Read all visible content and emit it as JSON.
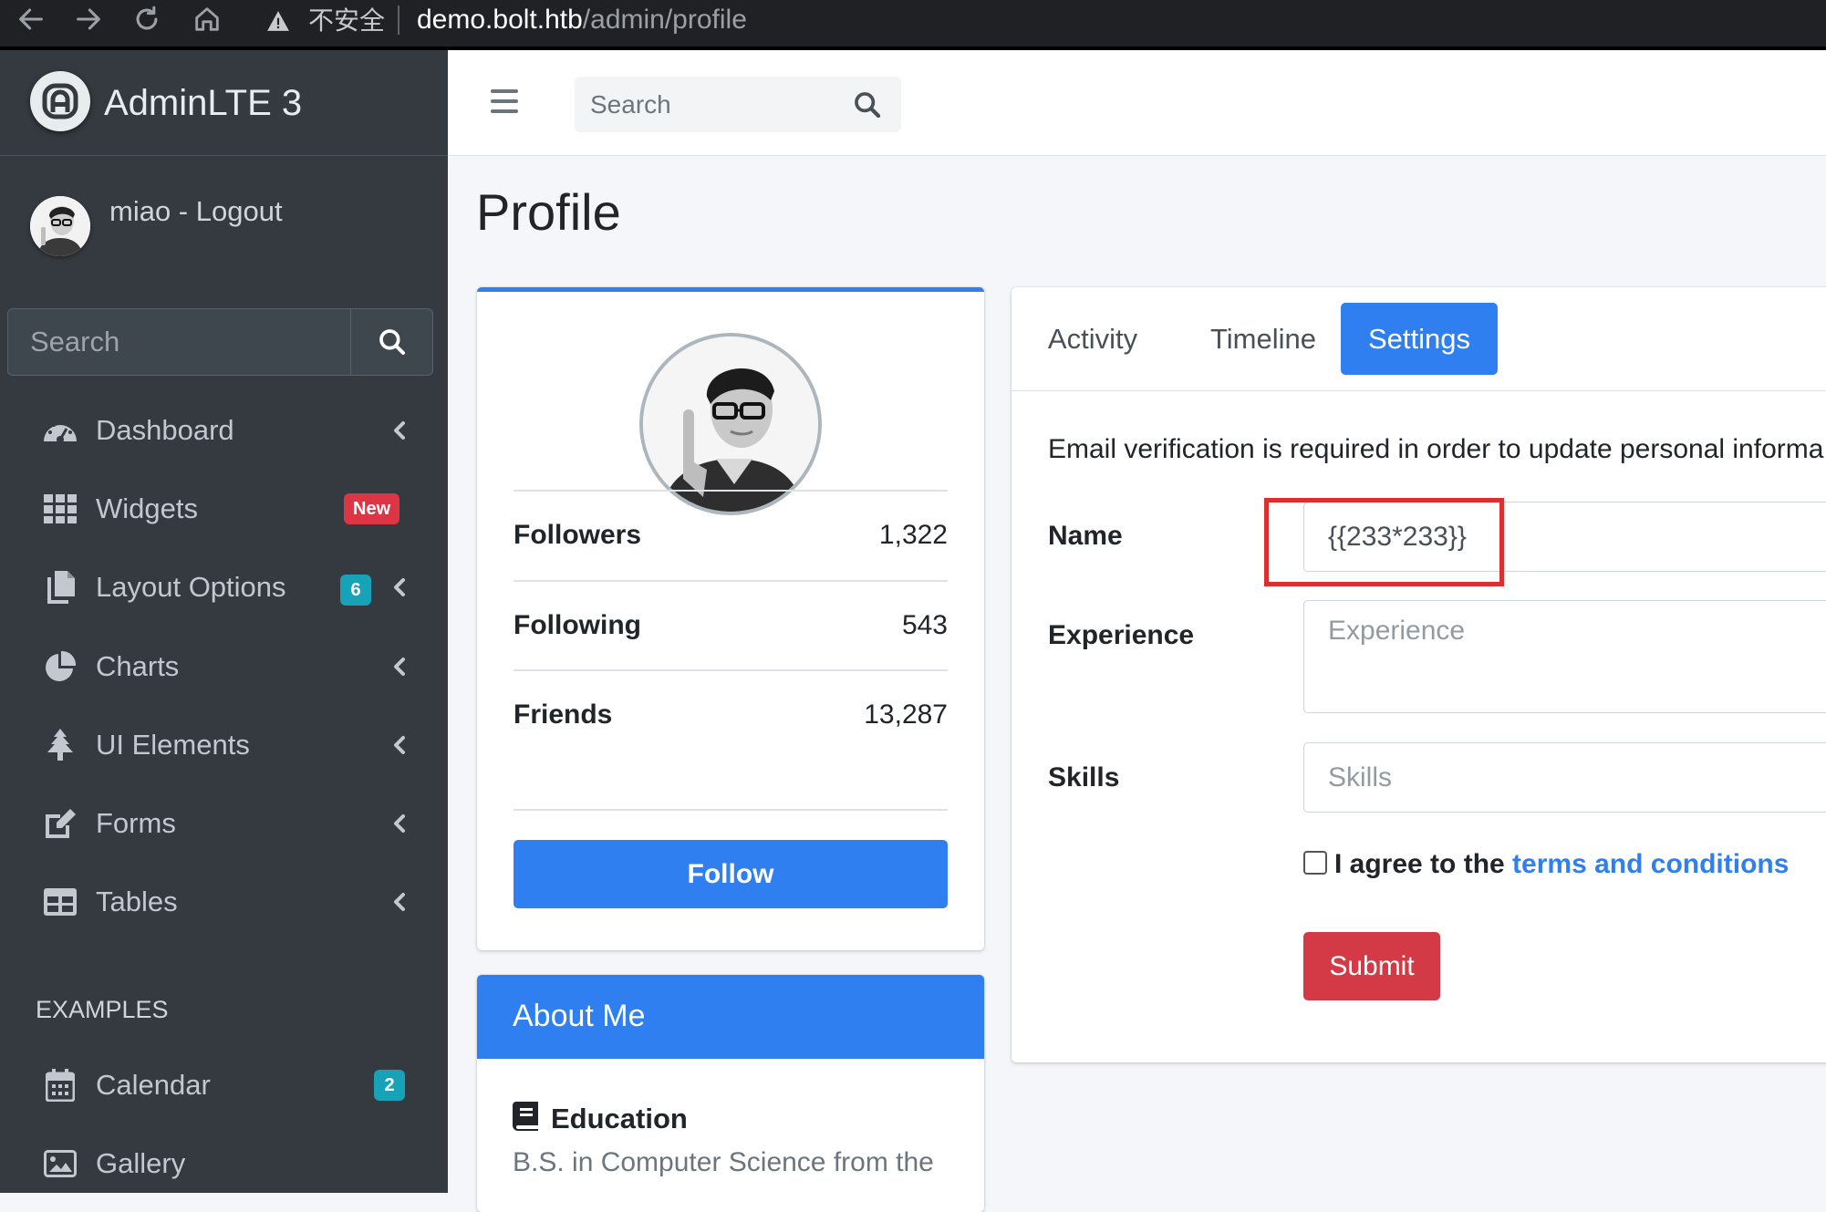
{
  "browser": {
    "insecure_label": "不安全",
    "url_host": "demo.bolt.htb",
    "url_path": "/admin/profile"
  },
  "sidebar": {
    "brand": "AdminLTE 3",
    "user": "miao - Logout",
    "search_placeholder": "Search",
    "items": [
      {
        "label": "Dashboard",
        "icon": "tachometer-icon"
      },
      {
        "label": "Widgets",
        "icon": "th-grid-icon",
        "badge": "New"
      },
      {
        "label": "Layout Options",
        "icon": "copy-icon",
        "badge": "6"
      },
      {
        "label": "Charts",
        "icon": "pie-chart-icon"
      },
      {
        "label": "UI Elements",
        "icon": "tree-icon"
      },
      {
        "label": "Forms",
        "icon": "edit-icon"
      },
      {
        "label": "Tables",
        "icon": "table-icon"
      }
    ],
    "header": "EXAMPLES",
    "examples": [
      {
        "label": "Calendar",
        "icon": "calendar-icon",
        "badge": "2"
      },
      {
        "label": "Gallery",
        "icon": "image-icon"
      }
    ]
  },
  "topbar": {
    "search_placeholder": "Search"
  },
  "page": {
    "title": "Profile"
  },
  "profile": {
    "stats": [
      {
        "label": "Followers",
        "value": "1,322"
      },
      {
        "label": "Following",
        "value": "543"
      },
      {
        "label": "Friends",
        "value": "13,287"
      }
    ],
    "follow_label": "Follow"
  },
  "about": {
    "title": "About Me",
    "education_title": "Education",
    "education_text": "B.S. in Computer Science from the"
  },
  "settings": {
    "tabs": [
      "Activity",
      "Timeline",
      "Settings"
    ],
    "active_tab": "Settings",
    "notice": "Email verification is required in order to update personal informa",
    "name_label": "Name",
    "name_value": "{{233*233}}",
    "experience_label": "Experience",
    "experience_placeholder": "Experience",
    "skills_label": "Skills",
    "skills_placeholder": "Skills",
    "agree_text": "I agree to the ",
    "agree_link": "terms and conditions",
    "submit_label": "Submit"
  },
  "colors": {
    "primary": "#2f7ff0",
    "danger": "#dc3545",
    "info": "#17a2b8",
    "sidebar_bg": "#343a40",
    "highlight": "#dc3030"
  }
}
